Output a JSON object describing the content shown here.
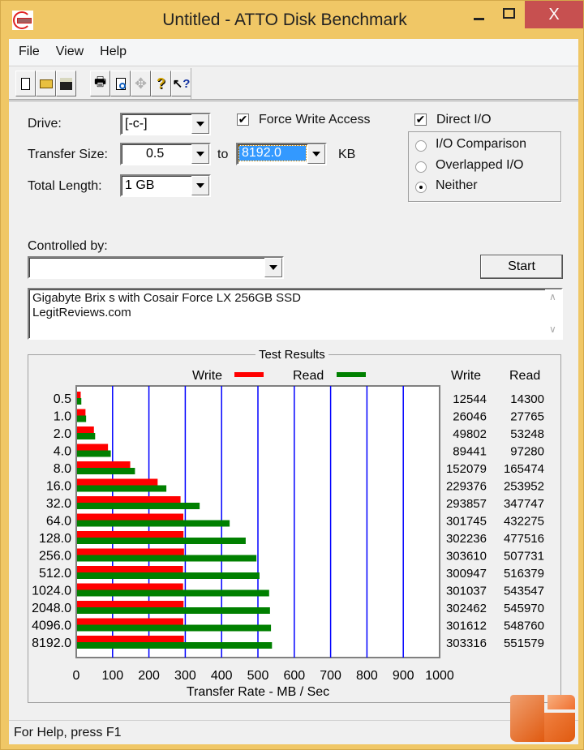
{
  "window": {
    "title": "Untitled - ATTO Disk Benchmark",
    "controls": {
      "minimize": "minimize",
      "maximize": "maximize",
      "close": "X"
    },
    "close_color": "#c75050",
    "frame_color": "#f0c766"
  },
  "menu": [
    {
      "label": "File"
    },
    {
      "label": "View"
    },
    {
      "label": "Help"
    }
  ],
  "toolbar": [
    {
      "icon": "new-document-icon",
      "glyph": "🗋"
    },
    {
      "icon": "open-folder-icon",
      "glyph": "📂"
    },
    {
      "icon": "save-disk-icon",
      "glyph": "💾"
    },
    {
      "icon": "print-icon",
      "glyph": "🖶"
    },
    {
      "icon": "print-preview-icon",
      "glyph": "🔍"
    },
    {
      "icon": "move-icon",
      "glyph": "✥"
    },
    {
      "icon": "help-icon",
      "glyph": "?"
    },
    {
      "icon": "context-help-icon",
      "glyph": "↖?"
    }
  ],
  "settings": {
    "drive_label": "Drive:",
    "drive_value": "[-c-]",
    "transfer_size_label": "Transfer Size:",
    "transfer_from": "0.5",
    "to_label": "to",
    "transfer_to": "8192.0",
    "unit_label": "KB",
    "total_length_label": "Total Length:",
    "total_length_value": "1 GB",
    "force_write_label": "Force Write Access",
    "force_write_checked": true,
    "direct_io_label": "Direct I/O",
    "direct_io_checked": true,
    "io_options": [
      {
        "label": "I/O Comparison",
        "selected": false
      },
      {
        "label": "Overlapped I/O",
        "selected": false
      },
      {
        "label": "Neither",
        "selected": true
      }
    ],
    "controlled_by_label": "Controlled by:",
    "controlled_by_value": "",
    "start_label": "Start",
    "description_lines": [
      "Gigabyte Brix s with Cosair Force LX 256GB SSD",
      "LegitReviews.com"
    ]
  },
  "results": {
    "title": "Test Results",
    "write_col": "Write",
    "read_col": "Read"
  },
  "status": {
    "text": "For Help, press F1"
  },
  "chart_data": {
    "type": "bar",
    "orientation": "horizontal",
    "title": "Test Results",
    "xlabel": "Transfer Rate - MB / Sec",
    "ylabel": "",
    "xlim": [
      0,
      1000
    ],
    "xticks": [
      "0",
      "100",
      "200",
      "300",
      "400",
      "500",
      "600",
      "700",
      "800",
      "900",
      "1000"
    ],
    "grid": true,
    "legend": "top-center",
    "categories": [
      "0.5",
      "1.0",
      "2.0",
      "4.0",
      "8.0",
      "16.0",
      "32.0",
      "64.0",
      "128.0",
      "256.0",
      "512.0",
      "1024.0",
      "2048.0",
      "4096.0",
      "8192.0"
    ],
    "series": [
      {
        "name": "Write",
        "color": "#ff0000",
        "values_kbps": [
          12544,
          26046,
          49802,
          89441,
          152079,
          229376,
          293857,
          301745,
          302236,
          303610,
          300947,
          301037,
          302462,
          301612,
          303316
        ]
      },
      {
        "name": "Read",
        "color": "#008000",
        "values_kbps": [
          14300,
          27765,
          53248,
          97280,
          165474,
          253952,
          347747,
          432275,
          477516,
          507731,
          516379,
          543547,
          545970,
          548760,
          551579
        ]
      }
    ],
    "grid_color": "#0000ff"
  }
}
